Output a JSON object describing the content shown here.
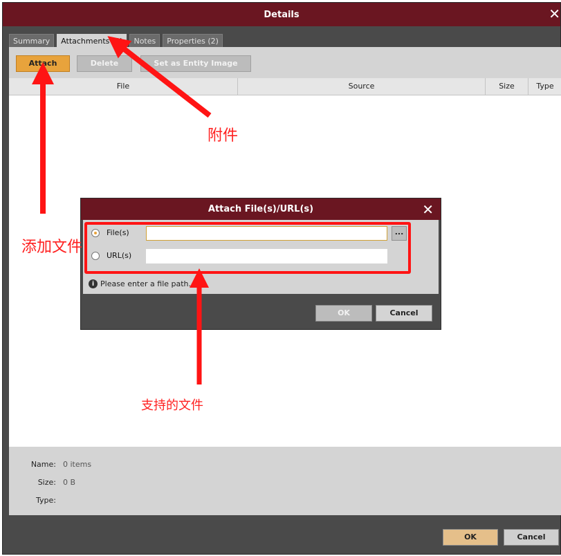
{
  "window": {
    "title": "Details",
    "close": "✕"
  },
  "tabs": [
    "Summary",
    "Attachments (0)",
    "Notes",
    "Properties (2)"
  ],
  "toolbar": {
    "attach": "Attach",
    "delete": "Delete",
    "entity_image": "Set as Entity Image"
  },
  "table": {
    "columns": [
      "File",
      "Source",
      "Size",
      "Type"
    ],
    "rows": []
  },
  "info": {
    "name_label": "Name:",
    "name_value": "0 items",
    "size_label": "Size:",
    "size_value": "0 B",
    "type_label": "Type:",
    "type_value": ""
  },
  "footer": {
    "ok": "OK",
    "cancel": "Cancel"
  },
  "dialog": {
    "title": "Attach File(s)/URL(s)",
    "close": "✕",
    "file_label": "File(s)",
    "url_label": "URL(s)",
    "file_value": "",
    "url_value": "",
    "browse": "...",
    "hint": "Please enter a file path.",
    "info_icon": "i",
    "ok": "OK",
    "cancel": "Cancel"
  },
  "annotations": {
    "attachments": "附件",
    "add_file": "添加文件",
    "supported_files": "支持的文件"
  },
  "colors": {
    "title_bar": "#6a1621",
    "accent": "#e8a33c",
    "annotation": "#ff1414"
  }
}
